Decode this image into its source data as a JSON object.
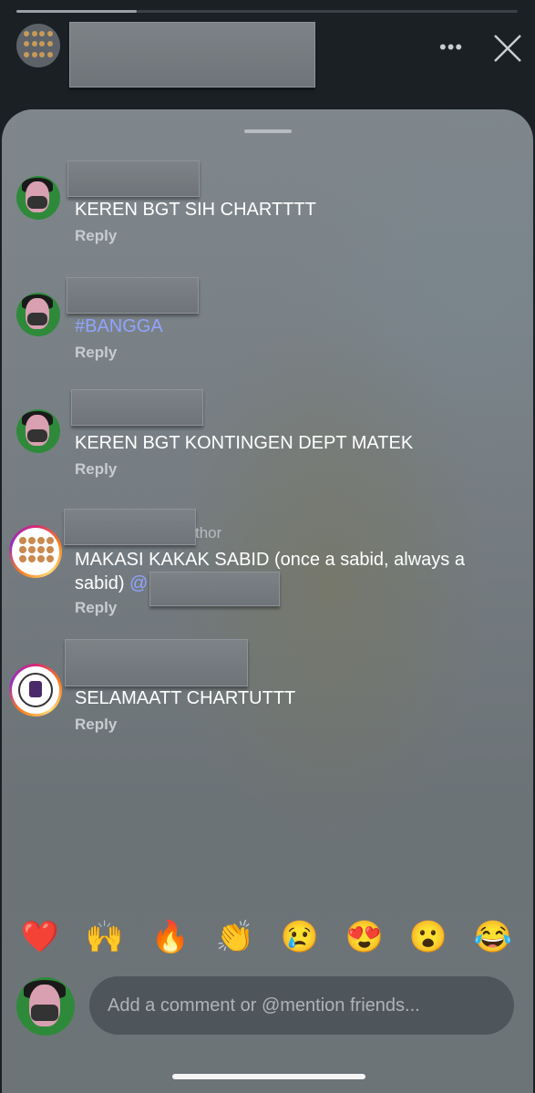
{
  "story": {
    "progress_fraction": 0.24
  },
  "header": {
    "more_label": "•••",
    "close_icon": "close-icon"
  },
  "comments": [
    {
      "text": "KEREN BGT SIH CHARTTTT",
      "reply_label": "Reply"
    },
    {
      "text": "#BANGGA",
      "reply_label": "Reply"
    },
    {
      "text": "KEREN BGT KONTINGEN DEPT MATEK",
      "reply_label": "Reply"
    },
    {
      "author_tag_partial": "thor",
      "text_line1": "MAKASI KAKAK SABID (once a sabid, always a",
      "text_line2": "sabid)",
      "mention_prefix": "@",
      "reply_label": "Reply"
    },
    {
      "text": "SELAMAATT CHARTUTTT",
      "reply_label": "Reply"
    }
  ],
  "reactions": [
    "❤️",
    "🙌",
    "🔥",
    "👏",
    "😢",
    "😍",
    "😮",
    "😂"
  ],
  "composer": {
    "placeholder": "Add a comment or @mention friends..."
  },
  "colors": {
    "hashtag": "#8fa4ff",
    "sheet_bg": "#767d82",
    "story_ring": "#d62976"
  }
}
